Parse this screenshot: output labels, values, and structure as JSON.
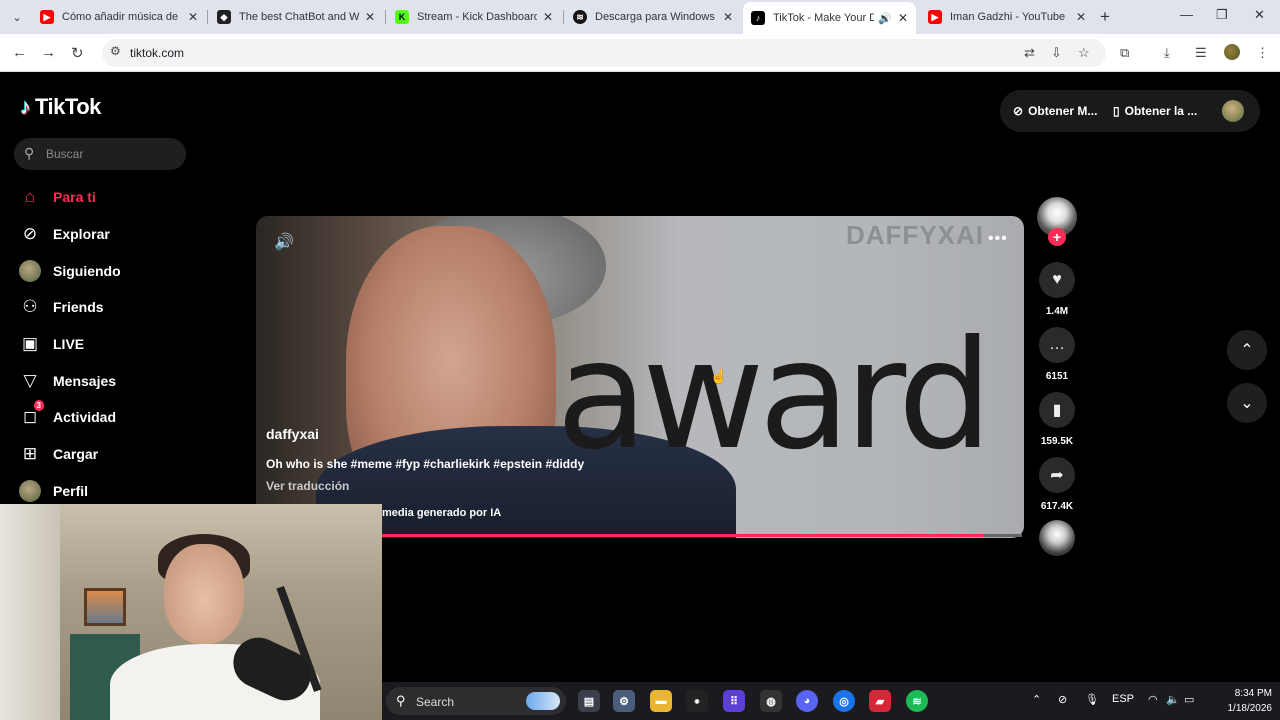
{
  "browser": {
    "tabs": [
      {
        "title": "Cómo añadir música de Sp",
        "icon": "youtube-icon",
        "color": "#ff0000"
      },
      {
        "title": "The best ChatBot and Wid",
        "icon": "chatbot-icon",
        "color": "#202124"
      },
      {
        "title": "Stream - Kick Dashboard",
        "icon": "kick-icon",
        "color": "#53fc18"
      },
      {
        "title": "Descarga para Windows -",
        "icon": "spotify-icon",
        "color": "#191414"
      },
      {
        "title": "TikTok - Make Your Da",
        "icon": "tiktok-icon",
        "color": "#000000",
        "active": true
      },
      {
        "title": "Iman Gadzhi - YouTube",
        "icon": "youtube-icon",
        "color": "#ff0000"
      }
    ],
    "url": "tiktok.com"
  },
  "tiktok": {
    "logo": "TikTok",
    "search_placeholder": "Buscar",
    "menu": [
      {
        "label": "Para ti",
        "icon": "home-icon",
        "active": true
      },
      {
        "label": "Explorar",
        "icon": "compass-icon"
      },
      {
        "label": "Siguiendo",
        "icon": "following-avatar-icon"
      },
      {
        "label": "Friends",
        "icon": "friends-icon"
      },
      {
        "label": "LIVE",
        "icon": "live-tv-icon"
      },
      {
        "label": "Mensajes",
        "icon": "send-icon"
      },
      {
        "label": "Actividad",
        "icon": "activity-icon",
        "badge": "3"
      },
      {
        "label": "Cargar",
        "icon": "upload-icon"
      },
      {
        "label": "Perfil",
        "icon": "profile-avatar-icon"
      }
    ],
    "top_bar": {
      "get_coins": "Obtener M...",
      "get_app": "Obtener la ..."
    },
    "video": {
      "watermark": "DAFFYXAI",
      "overlay_text": "award",
      "author": "daffyxai",
      "caption": "Oh who is she #meme #fyp #charliekirk #epstein #diddy",
      "translate": "Ver traducción",
      "ai_label": "media generado por IA",
      "progress": 0.94
    },
    "actions": {
      "likes": "1.4M",
      "comments": "6151",
      "saves": "159.5K",
      "shares": "617.4K"
    }
  },
  "taskbar": {
    "search_label": "Search",
    "language": "ESP",
    "time": "8:34 PM",
    "date": "1/18/2026"
  }
}
